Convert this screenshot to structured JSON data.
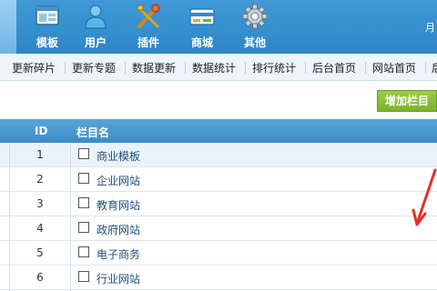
{
  "nav": {
    "items": [
      {
        "label": "模板",
        "icon": "template-window-icon"
      },
      {
        "label": "用户",
        "icon": "user-icon"
      },
      {
        "label": "插件",
        "icon": "tools-icon"
      },
      {
        "label": "商城",
        "icon": "shop-card-icon"
      },
      {
        "label": "其他",
        "icon": "gear-icon"
      }
    ],
    "edge_text": "月"
  },
  "submenu": [
    "更新碎片",
    "更新专题",
    "数据更新",
    "数据统计",
    "排行统计",
    "后台首页",
    "网站首页",
    "后"
  ],
  "toolbar": {
    "add_label": "增加栏目"
  },
  "table": {
    "headers": {
      "id": "ID",
      "name": "栏目名"
    },
    "rows": [
      {
        "id": "1",
        "name": "商业模板"
      },
      {
        "id": "2",
        "name": "企业网站"
      },
      {
        "id": "3",
        "name": "教育网站"
      },
      {
        "id": "4",
        "name": "政府网站"
      },
      {
        "id": "5",
        "name": "电子商务"
      },
      {
        "id": "6",
        "name": "行业网站"
      }
    ]
  },
  "colors": {
    "nav_bg": "#3f9ad6",
    "button_green": "#8cc23a",
    "annotation_red": "#e0322c"
  }
}
